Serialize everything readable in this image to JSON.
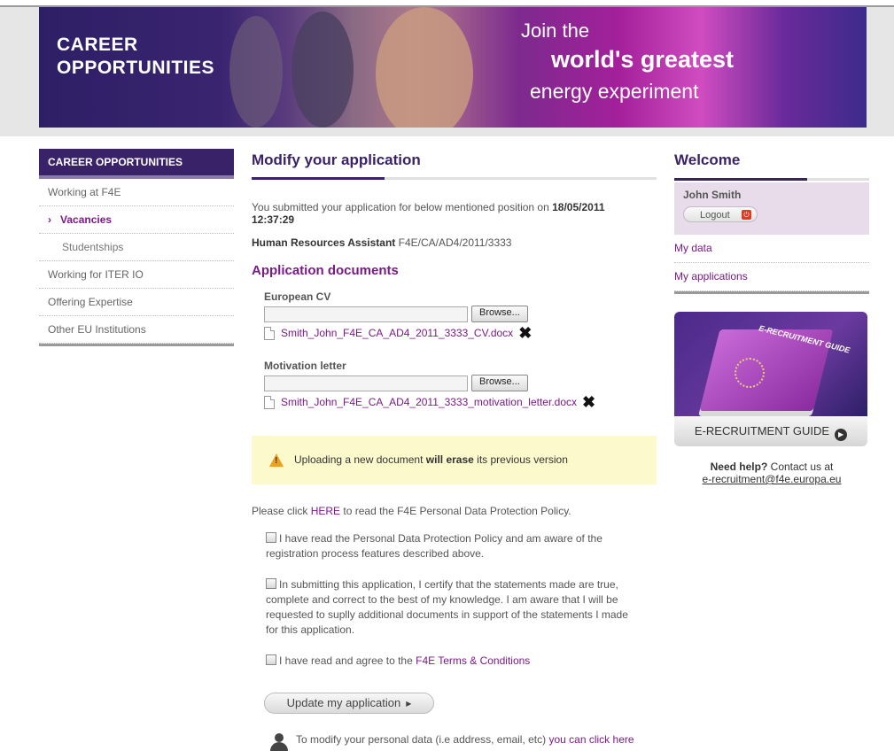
{
  "banner": {
    "title_line1": "CAREER",
    "title_line2": "OPPORTUNITIES",
    "join_line1": "Join the",
    "join_line2": "world's greatest",
    "join_line3": "energy experiment"
  },
  "leftnav": {
    "header": "CAREER OPPORTUNITIES",
    "items": [
      {
        "label": "Working at F4E"
      },
      {
        "label": "Vacancies",
        "active": true
      },
      {
        "label": "Studentships"
      },
      {
        "label": "Working for ITER IO"
      },
      {
        "label": "Offering Expertise"
      },
      {
        "label": "Other EU Institutions"
      }
    ],
    "chevron": "›"
  },
  "main": {
    "title": "Modify your application",
    "submitted_text": "You submitted your application for below mentioned position on",
    "submitted_date": "18/05/2011",
    "submitted_time": "12:37:29",
    "position_title": "Human Resources Assistant",
    "position_ref": "F4E/CA/AD4/2011/3333",
    "docs_title": "Application documents",
    "cv": {
      "label": "European CV",
      "browse": "Browse...",
      "filename": "Smith_John_F4E_CA_AD4_2011_3333_CV.docx"
    },
    "motivation": {
      "label": "Motivation letter",
      "browse": "Browse...",
      "filename": "Smith_John_F4E_CA_AD4_2011_3333_motivation_letter.docx"
    },
    "warning": {
      "pre": "Uploading a new document",
      "bold": "will erase",
      "post": "its previous version"
    },
    "policy": {
      "pre": "Please click",
      "link": "HERE",
      "post": "to read the F4E Personal Data Protection Policy."
    },
    "check1": "I have read the Personal Data Protection Policy and am aware of the registration process features described above.",
    "check2": "In submitting this application, I certify that the statements made are true, complete and correct to the best of my knowledge. I am aware that I will be requested to suplly additional documents in support of the statements I made for this application.",
    "check3_pre": "I have read and agree to the",
    "check3_link": "F4E Terms & Conditions",
    "update_button": "Update my application",
    "personal_pre": "To modify your personal data (i.e address, email, etc)",
    "personal_link": "you can click here"
  },
  "right": {
    "title": "Welcome",
    "user_name": "John Smith",
    "logout": "Logout",
    "links": [
      "My data",
      "My applications"
    ],
    "guide_book_text": "E-RECRUITMENT GUIDE",
    "guide_button": "E-RECRUITMENT GUIDE",
    "help_bold": "Need help?",
    "help_text": "Contact us at",
    "help_email": "e-recruitment@f4e.europa.eu"
  },
  "colors": {
    "primary": "#3a2268",
    "accent": "#7a1a86",
    "warning_bg": "#fcf9cd"
  }
}
